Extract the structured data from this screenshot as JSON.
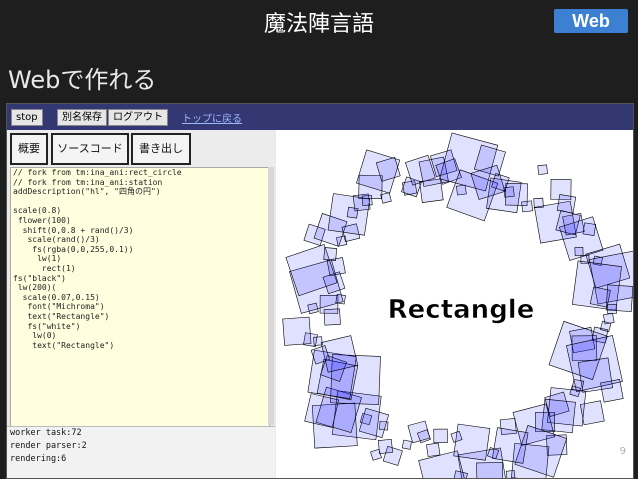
{
  "slide": {
    "title": "魔法陣言語",
    "badge": "Web",
    "subtitle": "Webで作れる",
    "page_number": "9"
  },
  "toolbar": {
    "stop_label": "stop",
    "save_as_label": "別名保存",
    "logout_label": "ログアウト",
    "top_link_label": "トップに戻る"
  },
  "tabs": [
    {
      "label": "概要"
    },
    {
      "label": "ソースコード"
    },
    {
      "label": "書き出し"
    }
  ],
  "code_lines": [
    "// fork from tm:ina_ani:rect_circle",
    "// fork from tm:ina_ani:station",
    "addDescription(\"hl\", \"四角の円\")",
    "",
    "scale(0.8)",
    " flower(100)",
    "  shift(0,0.8 + rand()/3)",
    "   scale(rand()/3)",
    "    fs(rgba(0,0,255,0.1))",
    "     lw(1)",
    "      rect(1)",
    "fs(\"black\")",
    " lw(200)(",
    "  scale(0.07,0.15)",
    "   font(\"Michroma\")",
    "   text(\"Rectangle\")",
    "   fs(\"white\")",
    "    lw(0)",
    "    text(\"Rectangle\")"
  ],
  "status": {
    "worker": "worker task:72",
    "parser": "render parser:2",
    "rendering": "rendering:6"
  },
  "canvas": {
    "label": "Rectangle",
    "fill_color": "#0000ff",
    "accent": "#343872"
  }
}
